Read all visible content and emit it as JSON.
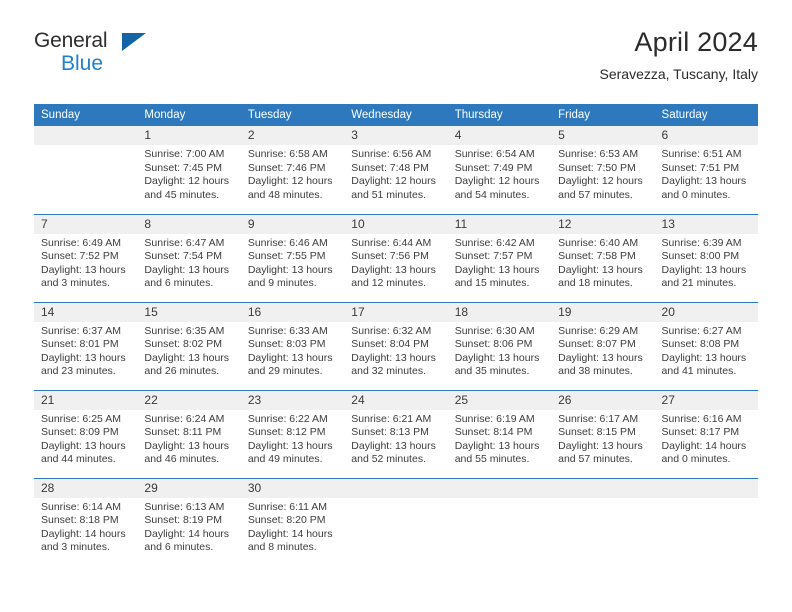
{
  "brand": {
    "name_part1": "General",
    "name_part2": "Blue",
    "accent_color": "#1f7fd0",
    "triangle_color": "#1464a5"
  },
  "header": {
    "title": "April 2024",
    "subtitle": "Seravezza, Tuscany, Italy"
  },
  "calendar": {
    "header_bg": "#2e79bd",
    "daynum_bg": "#f0f0f0",
    "weekdays": [
      "Sunday",
      "Monday",
      "Tuesday",
      "Wednesday",
      "Thursday",
      "Friday",
      "Saturday"
    ],
    "weeks": [
      [
        {
          "day": "",
          "sunrise": "",
          "sunset": "",
          "daylight1": "",
          "daylight2": ""
        },
        {
          "day": "1",
          "sunrise": "Sunrise: 7:00 AM",
          "sunset": "Sunset: 7:45 PM",
          "daylight1": "Daylight: 12 hours",
          "daylight2": "and 45 minutes."
        },
        {
          "day": "2",
          "sunrise": "Sunrise: 6:58 AM",
          "sunset": "Sunset: 7:46 PM",
          "daylight1": "Daylight: 12 hours",
          "daylight2": "and 48 minutes."
        },
        {
          "day": "3",
          "sunrise": "Sunrise: 6:56 AM",
          "sunset": "Sunset: 7:48 PM",
          "daylight1": "Daylight: 12 hours",
          "daylight2": "and 51 minutes."
        },
        {
          "day": "4",
          "sunrise": "Sunrise: 6:54 AM",
          "sunset": "Sunset: 7:49 PM",
          "daylight1": "Daylight: 12 hours",
          "daylight2": "and 54 minutes."
        },
        {
          "day": "5",
          "sunrise": "Sunrise: 6:53 AM",
          "sunset": "Sunset: 7:50 PM",
          "daylight1": "Daylight: 12 hours",
          "daylight2": "and 57 minutes."
        },
        {
          "day": "6",
          "sunrise": "Sunrise: 6:51 AM",
          "sunset": "Sunset: 7:51 PM",
          "daylight1": "Daylight: 13 hours",
          "daylight2": "and 0 minutes."
        }
      ],
      [
        {
          "day": "7",
          "sunrise": "Sunrise: 6:49 AM",
          "sunset": "Sunset: 7:52 PM",
          "daylight1": "Daylight: 13 hours",
          "daylight2": "and 3 minutes."
        },
        {
          "day": "8",
          "sunrise": "Sunrise: 6:47 AM",
          "sunset": "Sunset: 7:54 PM",
          "daylight1": "Daylight: 13 hours",
          "daylight2": "and 6 minutes."
        },
        {
          "day": "9",
          "sunrise": "Sunrise: 6:46 AM",
          "sunset": "Sunset: 7:55 PM",
          "daylight1": "Daylight: 13 hours",
          "daylight2": "and 9 minutes."
        },
        {
          "day": "10",
          "sunrise": "Sunrise: 6:44 AM",
          "sunset": "Sunset: 7:56 PM",
          "daylight1": "Daylight: 13 hours",
          "daylight2": "and 12 minutes."
        },
        {
          "day": "11",
          "sunrise": "Sunrise: 6:42 AM",
          "sunset": "Sunset: 7:57 PM",
          "daylight1": "Daylight: 13 hours",
          "daylight2": "and 15 minutes."
        },
        {
          "day": "12",
          "sunrise": "Sunrise: 6:40 AM",
          "sunset": "Sunset: 7:58 PM",
          "daylight1": "Daylight: 13 hours",
          "daylight2": "and 18 minutes."
        },
        {
          "day": "13",
          "sunrise": "Sunrise: 6:39 AM",
          "sunset": "Sunset: 8:00 PM",
          "daylight1": "Daylight: 13 hours",
          "daylight2": "and 21 minutes."
        }
      ],
      [
        {
          "day": "14",
          "sunrise": "Sunrise: 6:37 AM",
          "sunset": "Sunset: 8:01 PM",
          "daylight1": "Daylight: 13 hours",
          "daylight2": "and 23 minutes."
        },
        {
          "day": "15",
          "sunrise": "Sunrise: 6:35 AM",
          "sunset": "Sunset: 8:02 PM",
          "daylight1": "Daylight: 13 hours",
          "daylight2": "and 26 minutes."
        },
        {
          "day": "16",
          "sunrise": "Sunrise: 6:33 AM",
          "sunset": "Sunset: 8:03 PM",
          "daylight1": "Daylight: 13 hours",
          "daylight2": "and 29 minutes."
        },
        {
          "day": "17",
          "sunrise": "Sunrise: 6:32 AM",
          "sunset": "Sunset: 8:04 PM",
          "daylight1": "Daylight: 13 hours",
          "daylight2": "and 32 minutes."
        },
        {
          "day": "18",
          "sunrise": "Sunrise: 6:30 AM",
          "sunset": "Sunset: 8:06 PM",
          "daylight1": "Daylight: 13 hours",
          "daylight2": "and 35 minutes."
        },
        {
          "day": "19",
          "sunrise": "Sunrise: 6:29 AM",
          "sunset": "Sunset: 8:07 PM",
          "daylight1": "Daylight: 13 hours",
          "daylight2": "and 38 minutes."
        },
        {
          "day": "20",
          "sunrise": "Sunrise: 6:27 AM",
          "sunset": "Sunset: 8:08 PM",
          "daylight1": "Daylight: 13 hours",
          "daylight2": "and 41 minutes."
        }
      ],
      [
        {
          "day": "21",
          "sunrise": "Sunrise: 6:25 AM",
          "sunset": "Sunset: 8:09 PM",
          "daylight1": "Daylight: 13 hours",
          "daylight2": "and 44 minutes."
        },
        {
          "day": "22",
          "sunrise": "Sunrise: 6:24 AM",
          "sunset": "Sunset: 8:11 PM",
          "daylight1": "Daylight: 13 hours",
          "daylight2": "and 46 minutes."
        },
        {
          "day": "23",
          "sunrise": "Sunrise: 6:22 AM",
          "sunset": "Sunset: 8:12 PM",
          "daylight1": "Daylight: 13 hours",
          "daylight2": "and 49 minutes."
        },
        {
          "day": "24",
          "sunrise": "Sunrise: 6:21 AM",
          "sunset": "Sunset: 8:13 PM",
          "daylight1": "Daylight: 13 hours",
          "daylight2": "and 52 minutes."
        },
        {
          "day": "25",
          "sunrise": "Sunrise: 6:19 AM",
          "sunset": "Sunset: 8:14 PM",
          "daylight1": "Daylight: 13 hours",
          "daylight2": "and 55 minutes."
        },
        {
          "day": "26",
          "sunrise": "Sunrise: 6:17 AM",
          "sunset": "Sunset: 8:15 PM",
          "daylight1": "Daylight: 13 hours",
          "daylight2": "and 57 minutes."
        },
        {
          "day": "27",
          "sunrise": "Sunrise: 6:16 AM",
          "sunset": "Sunset: 8:17 PM",
          "daylight1": "Daylight: 14 hours",
          "daylight2": "and 0 minutes."
        }
      ],
      [
        {
          "day": "28",
          "sunrise": "Sunrise: 6:14 AM",
          "sunset": "Sunset: 8:18 PM",
          "daylight1": "Daylight: 14 hours",
          "daylight2": "and 3 minutes."
        },
        {
          "day": "29",
          "sunrise": "Sunrise: 6:13 AM",
          "sunset": "Sunset: 8:19 PM",
          "daylight1": "Daylight: 14 hours",
          "daylight2": "and 6 minutes."
        },
        {
          "day": "30",
          "sunrise": "Sunrise: 6:11 AM",
          "sunset": "Sunset: 8:20 PM",
          "daylight1": "Daylight: 14 hours",
          "daylight2": "and 8 minutes."
        },
        {
          "day": "",
          "sunrise": "",
          "sunset": "",
          "daylight1": "",
          "daylight2": ""
        },
        {
          "day": "",
          "sunrise": "",
          "sunset": "",
          "daylight1": "",
          "daylight2": ""
        },
        {
          "day": "",
          "sunrise": "",
          "sunset": "",
          "daylight1": "",
          "daylight2": ""
        },
        {
          "day": "",
          "sunrise": "",
          "sunset": "",
          "daylight1": "",
          "daylight2": ""
        }
      ]
    ]
  }
}
